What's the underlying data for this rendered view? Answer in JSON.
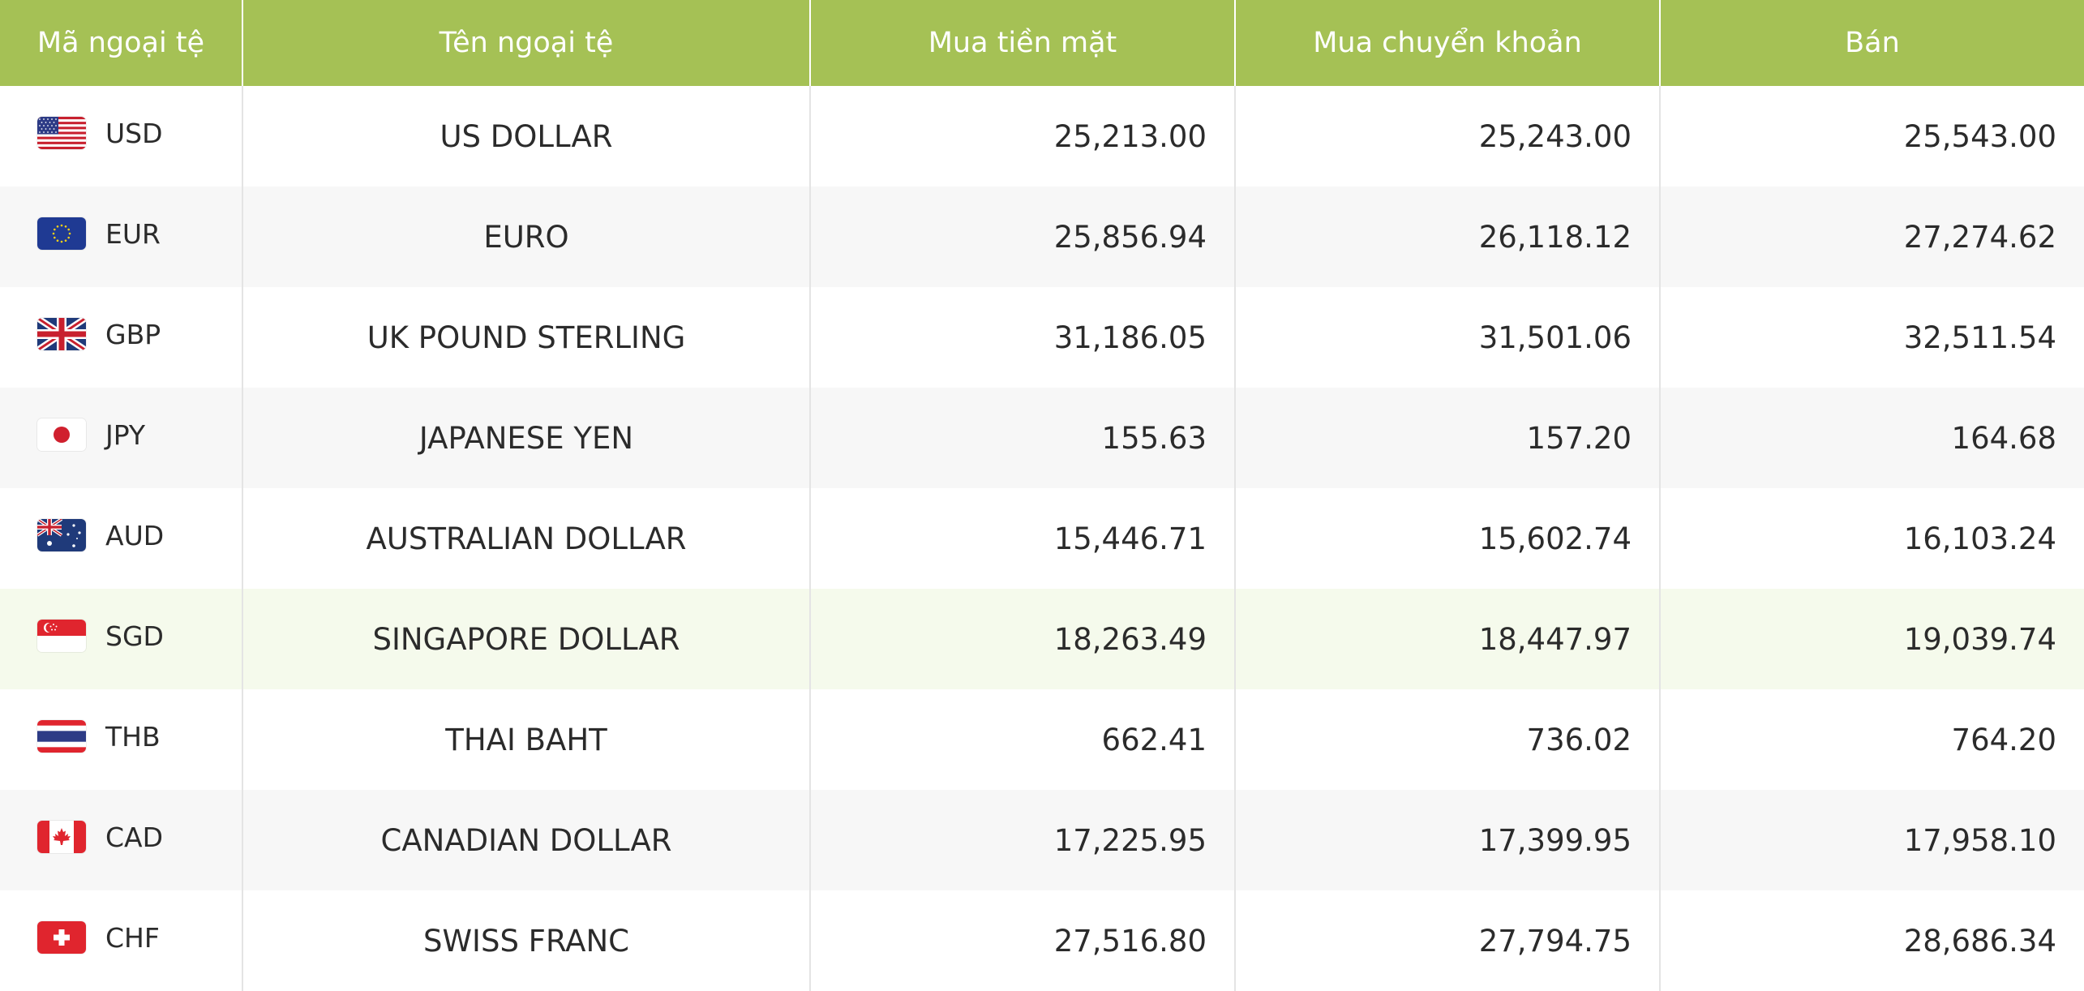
{
  "table": {
    "headers": {
      "code": "Mã ngoại tệ",
      "name": "Tên ngoại tệ",
      "cash_buy": "Mua tiền mặt",
      "transfer_buy": "Mua chuyển khoản",
      "sell": "Bán"
    },
    "rows": [
      {
        "code": "USD",
        "name": "US DOLLAR",
        "cash_buy": "25,213.00",
        "transfer_buy": "25,243.00",
        "sell": "25,543.00",
        "flag": "us-flag-icon"
      },
      {
        "code": "EUR",
        "name": "EURO",
        "cash_buy": "25,856.94",
        "transfer_buy": "26,118.12",
        "sell": "27,274.62",
        "flag": "eu-flag-icon"
      },
      {
        "code": "GBP",
        "name": "UK POUND STERLING",
        "cash_buy": "31,186.05",
        "transfer_buy": "31,501.06",
        "sell": "32,511.54",
        "flag": "uk-flag-icon"
      },
      {
        "code": "JPY",
        "name": "JAPANESE YEN",
        "cash_buy": "155.63",
        "transfer_buy": "157.20",
        "sell": "164.68",
        "flag": "japan-flag-icon"
      },
      {
        "code": "AUD",
        "name": "AUSTRALIAN DOLLAR",
        "cash_buy": "15,446.71",
        "transfer_buy": "15,602.74",
        "sell": "16,103.24",
        "flag": "australia-flag-icon"
      },
      {
        "code": "SGD",
        "name": "SINGAPORE DOLLAR",
        "cash_buy": "18,263.49",
        "transfer_buy": "18,447.97",
        "sell": "19,039.74",
        "flag": "singapore-flag-icon"
      },
      {
        "code": "THB",
        "name": "THAI BAHT",
        "cash_buy": "662.41",
        "transfer_buy": "736.02",
        "sell": "764.20",
        "flag": "thailand-flag-icon"
      },
      {
        "code": "CAD",
        "name": "CANADIAN DOLLAR",
        "cash_buy": "17,225.95",
        "transfer_buy": "17,399.95",
        "sell": "17,958.10",
        "flag": "canada-flag-icon"
      },
      {
        "code": "CHF",
        "name": "SWISS FRANC",
        "cash_buy": "27,516.80",
        "transfer_buy": "27,794.75",
        "sell": "28,686.34",
        "flag": "switzerland-flag-icon"
      }
    ]
  },
  "colors": {
    "header_background": "#a5c155",
    "header_text": "#ffffff",
    "row_alt_background": "#f7f7f7",
    "row_highlight_background": "#f5faec",
    "text": "#2b2b2b"
  }
}
